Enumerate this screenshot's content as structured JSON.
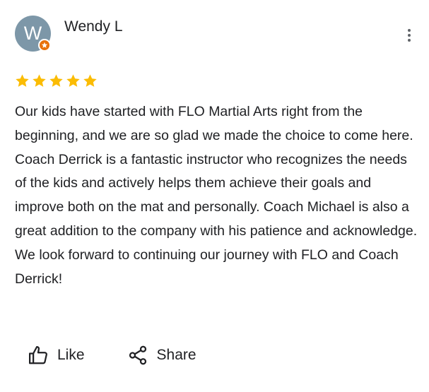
{
  "review": {
    "avatar_initial": "W",
    "reviewer_name": "Wendy L",
    "rating": 5,
    "rating_max": 5,
    "star_color": "#fbbc04",
    "text": "Our kids have started with FLO Martial Arts right from the beginning, and we are so glad we made the choice to come here. Coach Derrick is a fantastic instructor who recognizes the needs of the kids and actively helps them achieve their goals and improve both on the mat and personally. Coach Michael is also a great addition to the company with his patience and acknowledge. We look forward to continuing our journey with FLO and Coach Derrick!"
  },
  "actions": {
    "like_label": "Like",
    "share_label": "Share"
  },
  "colors": {
    "avatar_bg": "#7d97a8",
    "badge": "#e8710a",
    "text": "#202124"
  }
}
